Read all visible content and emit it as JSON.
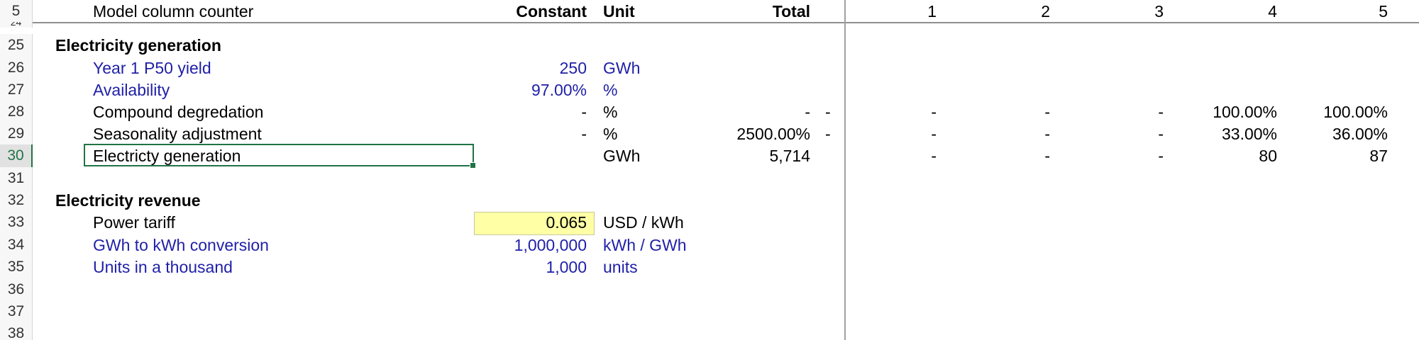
{
  "header": {
    "row_num": "5",
    "label": "Model column counter",
    "constant": "Constant",
    "unit": "Unit",
    "total": "Total",
    "years": [
      "1",
      "2",
      "3",
      "4",
      "5"
    ]
  },
  "partial_row_num": "24",
  "rows": [
    {
      "num": "25",
      "title": "Electricity generation"
    },
    {
      "num": "26",
      "label": "Year 1 P50 yield",
      "constant": "250",
      "unit": "GWh"
    },
    {
      "num": "27",
      "label": "Availability",
      "constant": "97.00%",
      "unit": "%"
    },
    {
      "num": "28",
      "label": "Compound degredation",
      "constant": "-",
      "unit": "%",
      "total": "-",
      "dash": "-",
      "years": [
        "-",
        "-",
        "-",
        "100.00%",
        "100.00%"
      ]
    },
    {
      "num": "29",
      "label": "Seasonality adjustment",
      "constant": "-",
      "unit": "%",
      "total": "2500.00%",
      "dash": "-",
      "years": [
        "-",
        "-",
        "-",
        "33.00%",
        "36.00%"
      ]
    },
    {
      "num": "30",
      "label": "Electricty generation",
      "unit": "GWh",
      "total": "5,714",
      "years": [
        "-",
        "-",
        "-",
        "80",
        "87"
      ]
    },
    {
      "num": "31"
    },
    {
      "num": "32",
      "title": "Electricity revenue"
    },
    {
      "num": "33",
      "label": "Power tariff",
      "constant": "0.065",
      "unit": "USD / kWh"
    },
    {
      "num": "34",
      "label": "GWh to kWh conversion",
      "constant": "1,000,000",
      "unit": "kWh / GWh"
    },
    {
      "num": "35",
      "label": "Units in a thousand",
      "constant": "1,000",
      "unit": "units"
    },
    {
      "num": "36"
    },
    {
      "num": "37"
    },
    {
      "num": "38"
    }
  ],
  "colors": {
    "input_text": "#1f1fa8",
    "input_fill": "#ffffa6",
    "selection": "#217346"
  }
}
